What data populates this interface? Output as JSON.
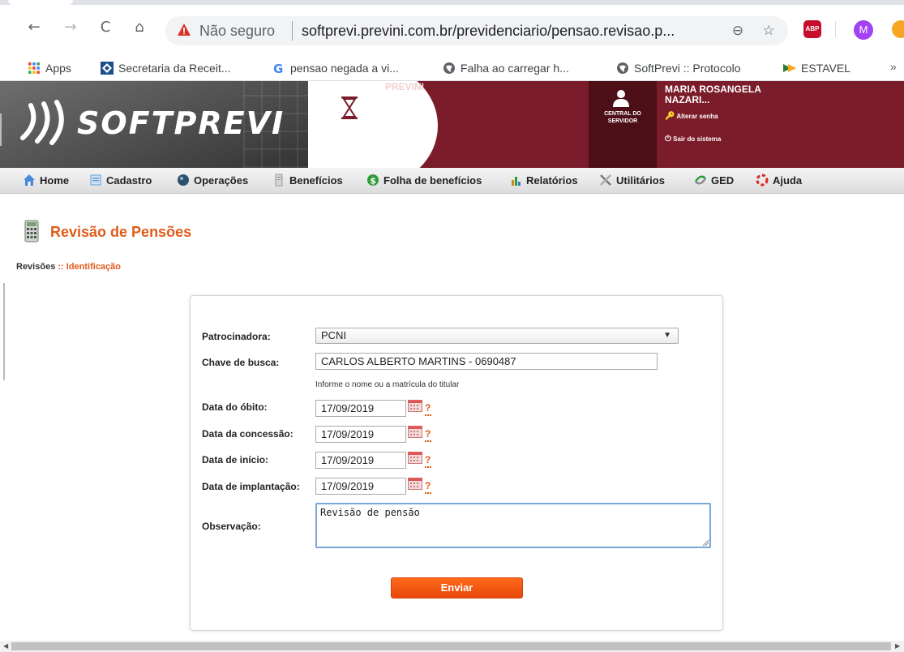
{
  "browser": {
    "insecure_label": "Não seguro",
    "url": "softprevi.previni.com.br/previdenciario/pensao.revisao.p...",
    "avatar_letter": "M",
    "abp_label": "ABP",
    "back_glyph": "←",
    "forward_glyph": "→",
    "reload_glyph": "C",
    "home_glyph": "⌂",
    "zoom_glyph": "⊖",
    "star_glyph": "☆",
    "more_glyph": "»"
  },
  "bookmarks": [
    {
      "label": "Apps",
      "icon": "apps-grid-icon"
    },
    {
      "label": "Secretaria da Receit...",
      "icon": "receita-icon"
    },
    {
      "label": "pensao negada a vi...",
      "icon": "google-icon"
    },
    {
      "label": "Falha ao carregar h...",
      "icon": "globe-icon"
    },
    {
      "label": "SoftPrevi :: Protocolo",
      "icon": "globe-icon"
    },
    {
      "label": "ESTAVEL",
      "icon": "estavel-icon"
    }
  ],
  "header": {
    "logo": "SOFTPREVI",
    "org": "PREVINI",
    "central_label_1": "CENTRAL DO",
    "central_label_2": "SERVIDOR",
    "user_name_1": "MARIA ROSANGELA",
    "user_name_2": "NAZARI...",
    "change_password": "Alterar senha",
    "logout": "Sair do sistema"
  },
  "menu": [
    {
      "label": "Home",
      "icon": "home-icon",
      "color": "#3b7dd8"
    },
    {
      "label": "Cadastro",
      "icon": "cadastro-icon",
      "color": "#6aa0d8"
    },
    {
      "label": "Operações",
      "icon": "operacoes-icon",
      "color": "#2f5f8f"
    },
    {
      "label": "Benefícios",
      "icon": "beneficios-icon",
      "color": "#9a9a9a"
    },
    {
      "label": "Folha de benefícios",
      "icon": "dollar-icon",
      "color": "#2e9b3a"
    },
    {
      "label": "Relatórios",
      "icon": "chart-icon",
      "color": "#d08a1a"
    },
    {
      "label": "Utilitários",
      "icon": "tools-icon",
      "color": "#777777"
    },
    {
      "label": "GED",
      "icon": "ged-icon",
      "color": "#2e9b3a"
    },
    {
      "label": "Ajuda",
      "icon": "help-ring-icon",
      "color": "#d22"
    }
  ],
  "page": {
    "title": "Revisão de Pensões",
    "breadcrumb_root": "Revisões",
    "breadcrumb_sep": "::",
    "breadcrumb_current": "Identificação"
  },
  "form": {
    "sponsor_label": "Patrocinadora:",
    "sponsor_value": "PCNI",
    "search_label": "Chave de busca:",
    "search_value": "CARLOS ALBERTO MARTINS - 0690487",
    "search_hint": "Informe o nome ou a matrícula do titular",
    "death_label": "Data do óbito:",
    "death_value": "17/09/2019",
    "grant_label": "Data da concessão:",
    "grant_value": "17/09/2019",
    "start_label": "Data de início:",
    "start_value": "17/09/2019",
    "impl_label": "Data de implantação:",
    "impl_value": "17/09/2019",
    "note_label": "Observação:",
    "note_value": "Revisão de pensão",
    "help_glyph": "?",
    "submit_label": "Enviar"
  },
  "colors": {
    "header_red": "#7b1c2a",
    "accent_orange": "#e05a18",
    "button_orange": "#f45b12"
  }
}
